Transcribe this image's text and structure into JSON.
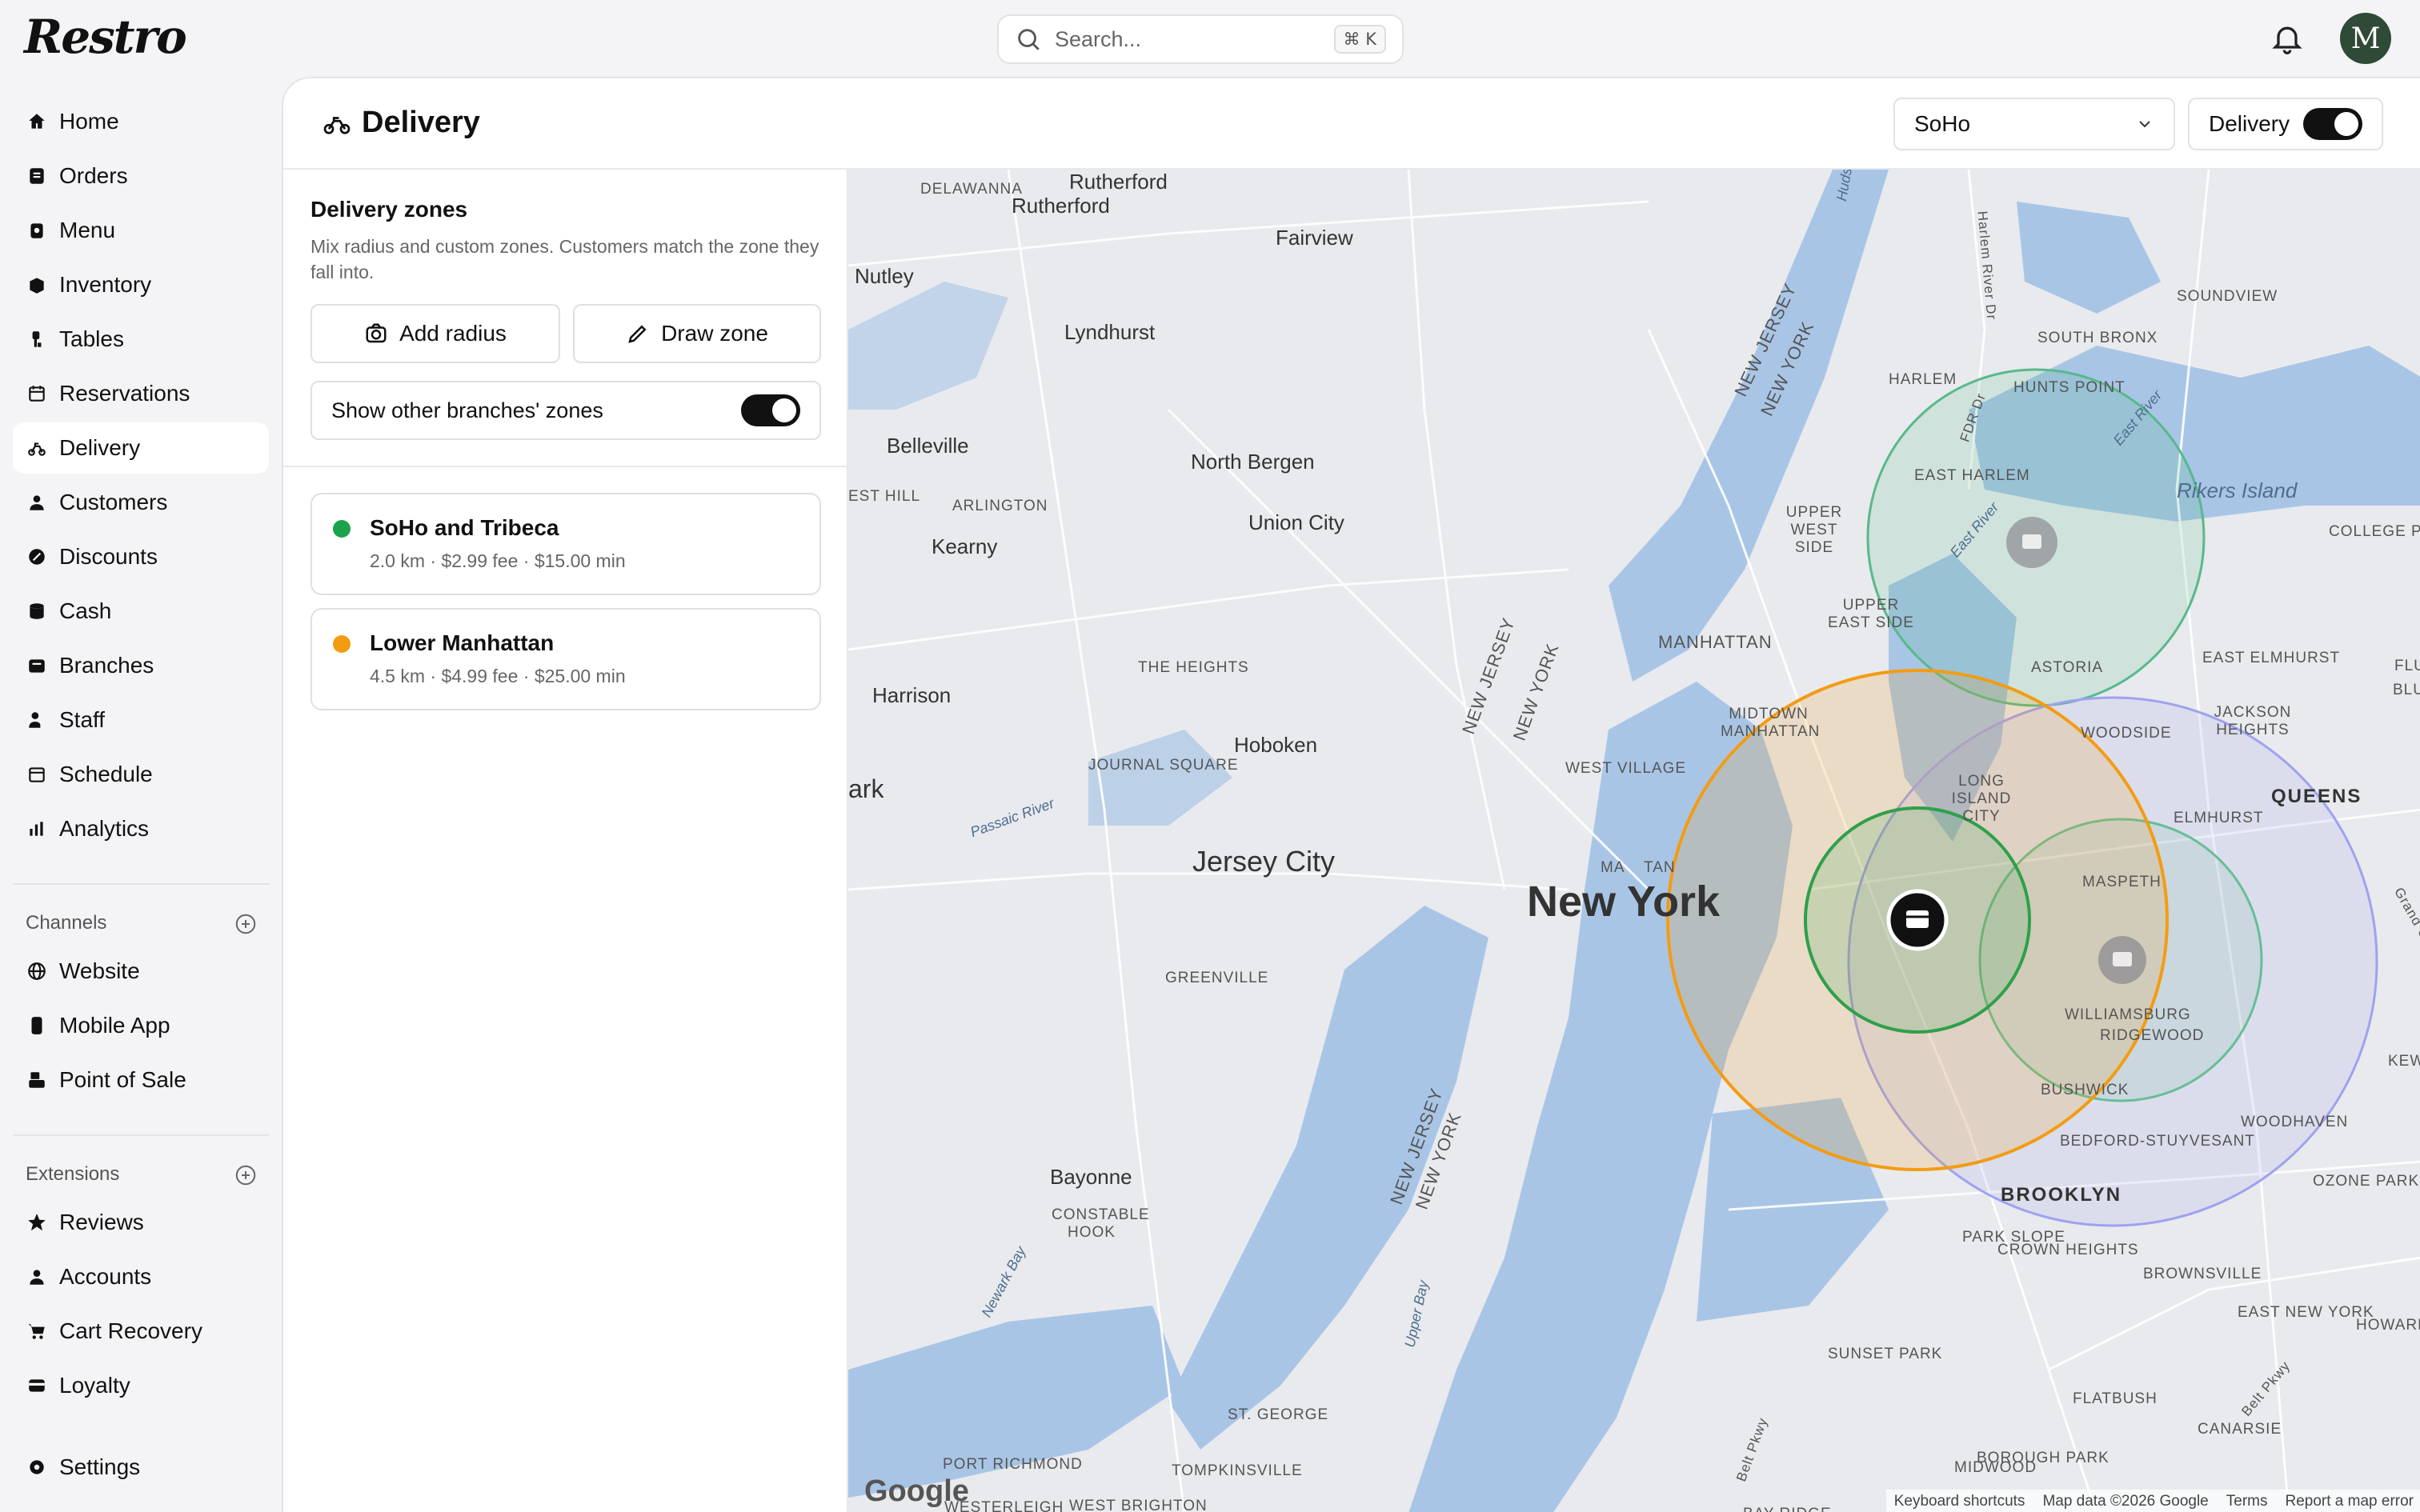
{
  "app": {
    "logo": "Restro"
  },
  "search": {
    "placeholder": "Search...",
    "shortcut": "⌘ K"
  },
  "user": {
    "initial": "M"
  },
  "sidebar": {
    "items": [
      {
        "label": "Home",
        "icon": "home-icon"
      },
      {
        "label": "Orders",
        "icon": "orders-icon"
      },
      {
        "label": "Menu",
        "icon": "menu-icon"
      },
      {
        "label": "Inventory",
        "icon": "inventory-icon"
      },
      {
        "label": "Tables",
        "icon": "tables-icon"
      },
      {
        "label": "Reservations",
        "icon": "calendar-icon"
      },
      {
        "label": "Delivery",
        "icon": "scooter-icon",
        "active": true
      },
      {
        "label": "Customers",
        "icon": "user-icon"
      },
      {
        "label": "Discounts",
        "icon": "discount-icon"
      },
      {
        "label": "Cash",
        "icon": "cash-icon"
      },
      {
        "label": "Branches",
        "icon": "branches-icon"
      },
      {
        "label": "Staff",
        "icon": "staff-icon"
      },
      {
        "label": "Schedule",
        "icon": "schedule-icon"
      },
      {
        "label": "Analytics",
        "icon": "analytics-icon"
      }
    ],
    "channels_label": "Channels",
    "channels": [
      {
        "label": "Website",
        "icon": "globe-icon"
      },
      {
        "label": "Mobile App",
        "icon": "phone-icon"
      },
      {
        "label": "Point of Sale",
        "icon": "pos-icon"
      }
    ],
    "extensions_label": "Extensions",
    "extensions": [
      {
        "label": "Reviews",
        "icon": "star-icon"
      },
      {
        "label": "Accounts",
        "icon": "user-icon"
      },
      {
        "label": "Cart Recovery",
        "icon": "cart-icon"
      },
      {
        "label": "Loyalty",
        "icon": "loyalty-icon"
      }
    ],
    "settings": {
      "label": "Settings",
      "icon": "gear-icon"
    }
  },
  "page": {
    "title": "Delivery",
    "branch": "SoHo",
    "delivery_toggle_label": "Delivery",
    "delivery_enabled": true
  },
  "panel": {
    "title": "Delivery zones",
    "description": "Mix radius and custom zones. Customers match the zone they fall into.",
    "add_radius": "Add radius",
    "draw_zone": "Draw zone",
    "show_other_label": "Show other branches' zones",
    "show_other_enabled": true,
    "zones": [
      {
        "name": "SoHo and Tribeca",
        "meta": "2.0 km · $2.99 fee · $15.00 min",
        "color": "#1aa34a"
      },
      {
        "name": "Lower Manhattan",
        "meta": "4.5 km · $4.99 fee · $25.00 min",
        "color": "#f39c12"
      }
    ]
  },
  "map": {
    "labels": {
      "rutherford": "Rutherford",
      "delawanna": "DELAWANNA",
      "fairview": "Fairview",
      "nutley": "Nutley",
      "lyndhurst": "Lyndhurst",
      "belleville": "Belleville",
      "north_bergen": "North Bergen",
      "union_city": "Union City",
      "arlington": "ARLINGTON",
      "east_hill": "EST HILL",
      "kearny": "Kearny",
      "harrison": "Harrison",
      "the_heights": "THE HEIGHTS",
      "journal_square": "JOURNAL SQUARE",
      "hoboken": "Hoboken",
      "jersey_city": "Jersey City",
      "new_york": "New York",
      "manhattan": "MANHATTAN",
      "midtown": "MIDTOWN MANHATTAN",
      "west_village": "WEST VILLAGE",
      "upper_west_side": "UPPER WEST SIDE",
      "upper_east_side": "UPPER EAST SIDE",
      "harlem": "HARLEM",
      "east_harlem": "EAST HARLEM",
      "south_bronx": "SOUTH BRONX",
      "hunts_point": "HUNTS POINT",
      "soundview": "SOUNDVIEW",
      "rikers": "Rikers Island",
      "college_point": "COLLEGE POI",
      "astoria": "ASTORIA",
      "east_elmhurst": "EAST ELMHURST",
      "jackson_heights": "JACKSON HEIGHTS",
      "woodside": "WOODSIDE",
      "long_island_city": "LONG ISLAND CITY",
      "queens": "QUEENS",
      "elmhurst": "ELMHURST",
      "maspeth": "MASPETH",
      "williamsburg": "WILLIAMSBURG",
      "ridgewood": "RIDGEWOOD",
      "bushwick": "BUSHWICK",
      "bedford": "BEDFORD-STUYVESANT",
      "brooklyn": "BROOKLYN",
      "woodhaven": "WOODHAVEN",
      "ozone_park": "OZONE PARK",
      "park_slope": "PARK SLOPE",
      "crown_heights": "CROWN HEIGHTS",
      "brownsville": "BROWNSVILLE",
      "east_new_york": "EAST NEW YORK",
      "howard_beach": "HOWARD BEAC",
      "sunset_park": "SUNSET PARK",
      "flatbush": "FLATBUSH",
      "canarsie": "CANARSIE",
      "borough_park": "BOROUGH PARK",
      "bay_ridge": "BAY RIDGE",
      "midwood": "MIDWOOD",
      "greenville": "GREENVILLE",
      "bayonne": "Bayonne",
      "constable_hook": "CONSTABLE HOOK",
      "st_george": "ST. GEORGE",
      "port_richmond": "PORT RICHMOND",
      "tompkinsville": "TOMPKINSVILLE",
      "west_brighton": "WEST BRIGHTON",
      "westerleigh": "WESTERLEIGH",
      "ark": "ark",
      "passaic_river": "Passaic River",
      "newark_bay": "Newark Bay",
      "upper_bay": "Upper Bay",
      "east_river": "East River",
      "hudson": "Huds",
      "nj_ny_1": "NEW JERSEY",
      "nj_ny_2": "NEW YORK",
      "harlem_river": "Harlem River Dr",
      "fdr": "FDR Dr",
      "belt_pkwy": "Belt Pkwy",
      "manhattan_label": "MA",
      "manhattan_label2": "TAN",
      "grand": "Grand C",
      "kew": "KEW",
      "flu": "FLU",
      "blu": "BLU"
    },
    "google": "Google",
    "footer": {
      "shortcuts": "Keyboard shortcuts",
      "data": "Map data ©2026 Google",
      "terms": "Terms",
      "report": "Report a map error"
    }
  }
}
